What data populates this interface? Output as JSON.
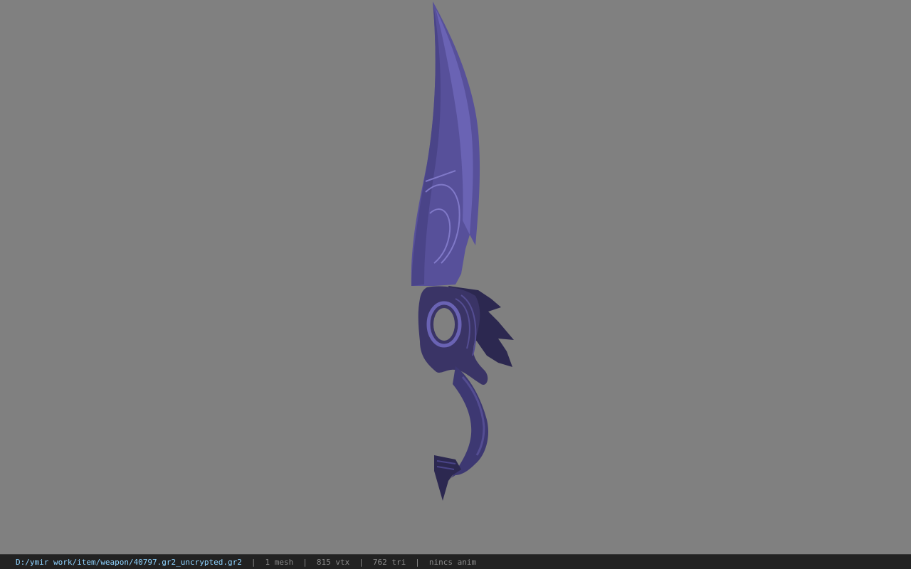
{
  "viewport": {
    "background_color": "#808080",
    "model": "weapon-blade"
  },
  "colors": {
    "blade": "#57509a",
    "blade_light": "#6a63b4",
    "blade_dark": "#3d3872",
    "guard": "#3a3466",
    "guard_dark": "#221f3e",
    "path_text": "#8fd3ff"
  },
  "statusbar": {
    "path": "D:/ymir work/item/weapon/40797.gr2_uncrypted.gr2",
    "separator": "|",
    "mesh": "1 mesh",
    "vertices": "815 vtx",
    "triangles": "762 tri",
    "anim": "nincs anim"
  }
}
